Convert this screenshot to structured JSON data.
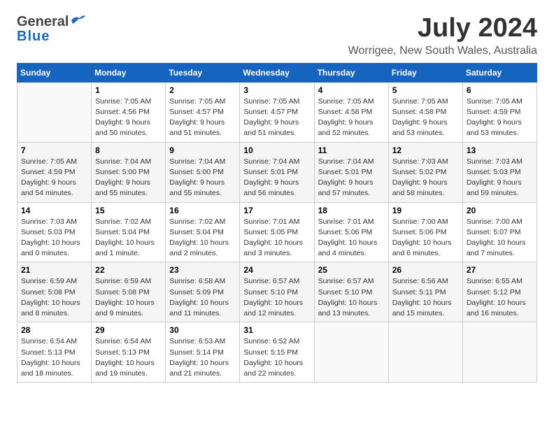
{
  "header": {
    "logo_general": "General",
    "logo_blue": "Blue",
    "month": "July 2024",
    "location": "Worrigee, New South Wales, Australia"
  },
  "days_of_week": [
    "Sunday",
    "Monday",
    "Tuesday",
    "Wednesday",
    "Thursday",
    "Friday",
    "Saturday"
  ],
  "weeks": [
    [
      {
        "day": "",
        "info": ""
      },
      {
        "day": "1",
        "info": "Sunrise: 7:05 AM\nSunset: 4:56 PM\nDaylight: 9 hours\nand 50 minutes."
      },
      {
        "day": "2",
        "info": "Sunrise: 7:05 AM\nSunset: 4:57 PM\nDaylight: 9 hours\nand 51 minutes."
      },
      {
        "day": "3",
        "info": "Sunrise: 7:05 AM\nSunset: 4:57 PM\nDaylight: 9 hours\nand 51 minutes."
      },
      {
        "day": "4",
        "info": "Sunrise: 7:05 AM\nSunset: 4:58 PM\nDaylight: 9 hours\nand 52 minutes."
      },
      {
        "day": "5",
        "info": "Sunrise: 7:05 AM\nSunset: 4:58 PM\nDaylight: 9 hours\nand 53 minutes."
      },
      {
        "day": "6",
        "info": "Sunrise: 7:05 AM\nSunset: 4:59 PM\nDaylight: 9 hours\nand 53 minutes."
      }
    ],
    [
      {
        "day": "7",
        "info": "Sunrise: 7:05 AM\nSunset: 4:59 PM\nDaylight: 9 hours\nand 54 minutes."
      },
      {
        "day": "8",
        "info": "Sunrise: 7:04 AM\nSunset: 5:00 PM\nDaylight: 9 hours\nand 55 minutes."
      },
      {
        "day": "9",
        "info": "Sunrise: 7:04 AM\nSunset: 5:00 PM\nDaylight: 9 hours\nand 55 minutes."
      },
      {
        "day": "10",
        "info": "Sunrise: 7:04 AM\nSunset: 5:01 PM\nDaylight: 9 hours\nand 56 minutes."
      },
      {
        "day": "11",
        "info": "Sunrise: 7:04 AM\nSunset: 5:01 PM\nDaylight: 9 hours\nand 57 minutes."
      },
      {
        "day": "12",
        "info": "Sunrise: 7:03 AM\nSunset: 5:02 PM\nDaylight: 9 hours\nand 58 minutes."
      },
      {
        "day": "13",
        "info": "Sunrise: 7:03 AM\nSunset: 5:03 PM\nDaylight: 9 hours\nand 59 minutes."
      }
    ],
    [
      {
        "day": "14",
        "info": "Sunrise: 7:03 AM\nSunset: 5:03 PM\nDaylight: 10 hours\nand 0 minutes."
      },
      {
        "day": "15",
        "info": "Sunrise: 7:02 AM\nSunset: 5:04 PM\nDaylight: 10 hours\nand 1 minute."
      },
      {
        "day": "16",
        "info": "Sunrise: 7:02 AM\nSunset: 5:04 PM\nDaylight: 10 hours\nand 2 minutes."
      },
      {
        "day": "17",
        "info": "Sunrise: 7:01 AM\nSunset: 5:05 PM\nDaylight: 10 hours\nand 3 minutes."
      },
      {
        "day": "18",
        "info": "Sunrise: 7:01 AM\nSunset: 5:06 PM\nDaylight: 10 hours\nand 4 minutes."
      },
      {
        "day": "19",
        "info": "Sunrise: 7:00 AM\nSunset: 5:06 PM\nDaylight: 10 hours\nand 6 minutes."
      },
      {
        "day": "20",
        "info": "Sunrise: 7:00 AM\nSunset: 5:07 PM\nDaylight: 10 hours\nand 7 minutes."
      }
    ],
    [
      {
        "day": "21",
        "info": "Sunrise: 6:59 AM\nSunset: 5:08 PM\nDaylight: 10 hours\nand 8 minutes."
      },
      {
        "day": "22",
        "info": "Sunrise: 6:59 AM\nSunset: 5:08 PM\nDaylight: 10 hours\nand 9 minutes."
      },
      {
        "day": "23",
        "info": "Sunrise: 6:58 AM\nSunset: 5:09 PM\nDaylight: 10 hours\nand 11 minutes."
      },
      {
        "day": "24",
        "info": "Sunrise: 6:57 AM\nSunset: 5:10 PM\nDaylight: 10 hours\nand 12 minutes."
      },
      {
        "day": "25",
        "info": "Sunrise: 6:57 AM\nSunset: 5:10 PM\nDaylight: 10 hours\nand 13 minutes."
      },
      {
        "day": "26",
        "info": "Sunrise: 6:56 AM\nSunset: 5:11 PM\nDaylight: 10 hours\nand 15 minutes."
      },
      {
        "day": "27",
        "info": "Sunrise: 6:55 AM\nSunset: 5:12 PM\nDaylight: 10 hours\nand 16 minutes."
      }
    ],
    [
      {
        "day": "28",
        "info": "Sunrise: 6:54 AM\nSunset: 5:13 PM\nDaylight: 10 hours\nand 18 minutes."
      },
      {
        "day": "29",
        "info": "Sunrise: 6:54 AM\nSunset: 5:13 PM\nDaylight: 10 hours\nand 19 minutes."
      },
      {
        "day": "30",
        "info": "Sunrise: 6:53 AM\nSunset: 5:14 PM\nDaylight: 10 hours\nand 21 minutes."
      },
      {
        "day": "31",
        "info": "Sunrise: 6:52 AM\nSunset: 5:15 PM\nDaylight: 10 hours\nand 22 minutes."
      },
      {
        "day": "",
        "info": ""
      },
      {
        "day": "",
        "info": ""
      },
      {
        "day": "",
        "info": ""
      }
    ]
  ]
}
